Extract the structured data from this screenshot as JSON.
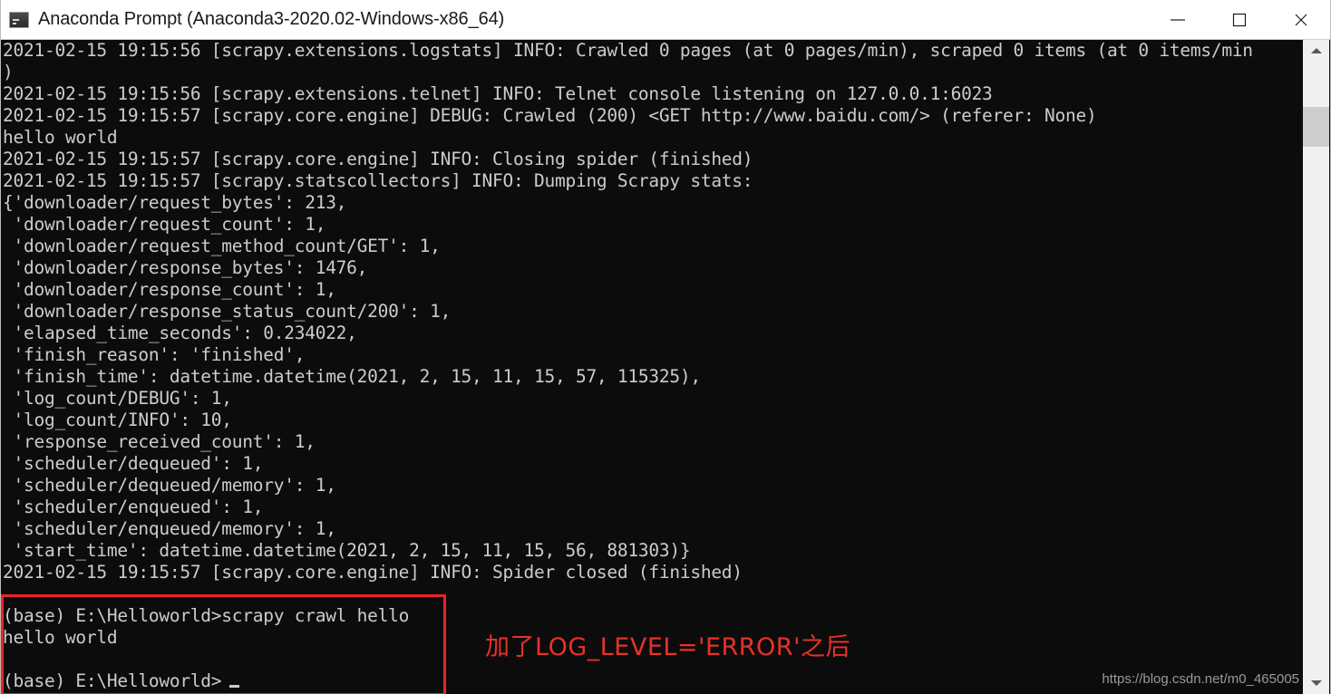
{
  "window": {
    "title": "Anaconda Prompt (Anaconda3-2020.02-Windows-x86_64)",
    "icon": "console-icon",
    "controls": {
      "minimize": "minimize-icon",
      "maximize": "maximize-icon",
      "close": "close-icon"
    }
  },
  "terminal": {
    "prompt_cwd": "(base) E:\\Helloworld>",
    "command": "scrapy crawl hello",
    "lines": [
      "2021-02-15 19:15:56 [scrapy.extensions.logstats] INFO: Crawled 0 pages (at 0 pages/min), scraped 0 items (at 0 items/min",
      ")",
      "2021-02-15 19:15:56 [scrapy.extensions.telnet] INFO: Telnet console listening on 127.0.0.1:6023",
      "2021-02-15 19:15:57 [scrapy.core.engine] DEBUG: Crawled (200) <GET http://www.baidu.com/> (referer: None)",
      "hello world",
      "2021-02-15 19:15:57 [scrapy.core.engine] INFO: Closing spider (finished)",
      "2021-02-15 19:15:57 [scrapy.statscollectors] INFO: Dumping Scrapy stats:",
      "{'downloader/request_bytes': 213,",
      " 'downloader/request_count': 1,",
      " 'downloader/request_method_count/GET': 1,",
      " 'downloader/response_bytes': 1476,",
      " 'downloader/response_count': 1,",
      " 'downloader/response_status_count/200': 1,",
      " 'elapsed_time_seconds': 0.234022,",
      " 'finish_reason': 'finished',",
      " 'finish_time': datetime.datetime(2021, 2, 15, 11, 15, 57, 115325),",
      " 'log_count/DEBUG': 1,",
      " 'log_count/INFO': 10,",
      " 'response_received_count': 1,",
      " 'scheduler/dequeued': 1,",
      " 'scheduler/dequeued/memory': 1,",
      " 'scheduler/enqueued': 1,",
      " 'scheduler/enqueued/memory': 1,",
      " 'start_time': datetime.datetime(2021, 2, 15, 11, 15, 56, 881303)}",
      "2021-02-15 19:15:57 [scrapy.core.engine] INFO: Spider closed (finished)",
      "",
      "(base) E:\\Helloworld>scrapy crawl hello",
      "hello world",
      "",
      "(base) E:\\Helloworld>"
    ]
  },
  "annotations": {
    "red_note": "加了LOG_LEVEL='ERROR'之后",
    "red_note_color": "#e8312a",
    "highlight_box_color": "#ef2222"
  },
  "watermark": {
    "text": "https://blog.csdn.net/m0_465005"
  },
  "scrollbar": {
    "up_arrow": "chevron-up-icon",
    "down_arrow": "chevron-down-icon"
  },
  "colors": {
    "terminal_background": "#0c0c0c",
    "terminal_text": "#cccccc",
    "titlebar_background": "#ffffff"
  }
}
